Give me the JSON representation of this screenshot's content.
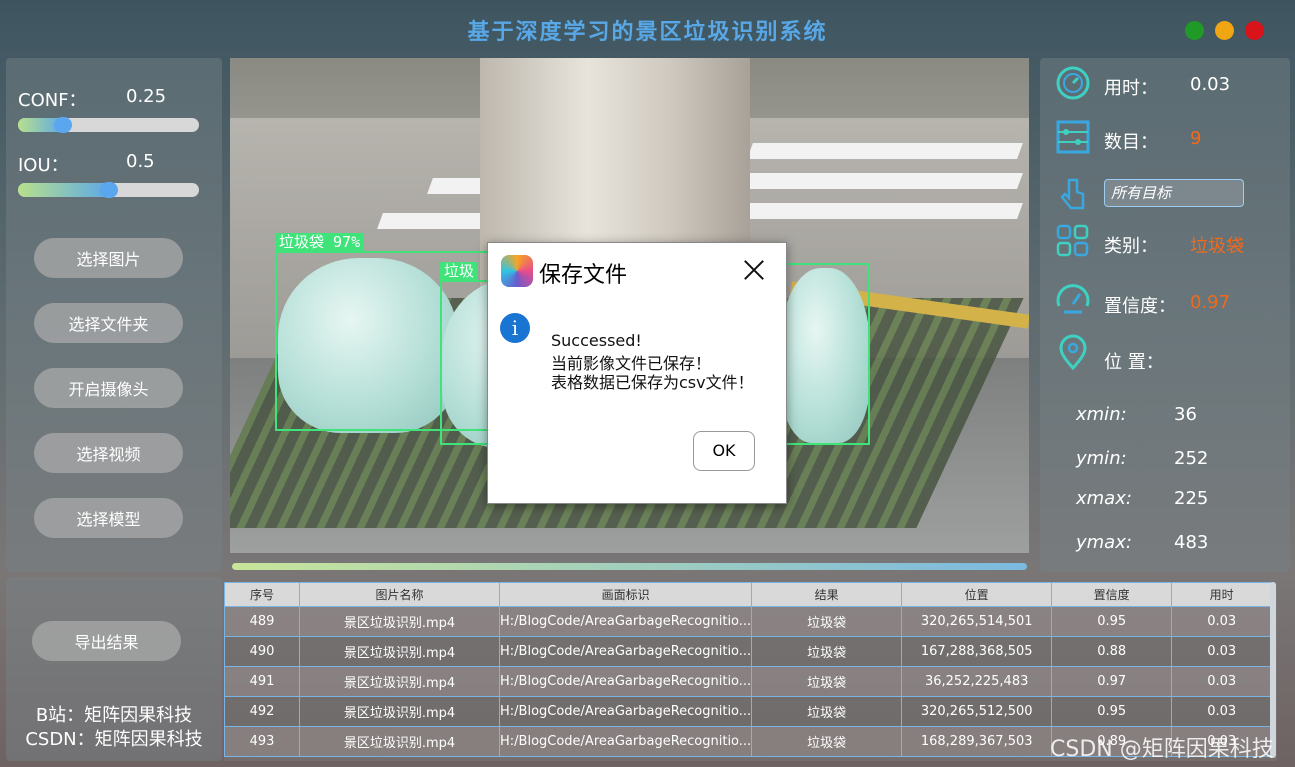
{
  "app": {
    "title": "基于深度学习的景区垃圾识别系统"
  },
  "window_controls": {
    "colors": [
      "#1f9a26",
      "#f0a512",
      "#d9131a"
    ]
  },
  "left_panel": {
    "conf": {
      "label": "CONF：",
      "value": "0.25",
      "fraction": 0.25
    },
    "iou": {
      "label": "IOU：",
      "value": "0.5",
      "fraction": 0.5
    },
    "buttons": [
      "选择图片",
      "选择文件夹",
      "开启摄像头",
      "选择视频",
      "选择模型"
    ],
    "export_button": "导出结果",
    "footer_lines": [
      "B站：矩阵因果科技",
      "CSDN：矩阵因果科技"
    ]
  },
  "detections": [
    {
      "label": "垃圾袋 97%"
    },
    {
      "label": "垃圾"
    }
  ],
  "right_panel": {
    "time": {
      "label": "用时：",
      "value": "0.03",
      "icon": "clock-gauge-icon"
    },
    "count": {
      "label": "数目：",
      "value": "9",
      "icon": "abacus-icon"
    },
    "target_select": {
      "label": "所有目标",
      "icon": "pointer-hand-icon"
    },
    "category": {
      "label": "类别：",
      "value": "垃圾袋",
      "icon": "grid-icon"
    },
    "confidence": {
      "label": "置信度：",
      "value": "0.97",
      "icon": "speedometer-icon"
    },
    "position": {
      "label": "位 置：",
      "icon": "location-pin-icon"
    },
    "coords": [
      {
        "label": "xmin:",
        "value": "36"
      },
      {
        "label": "ymin:",
        "value": "252"
      },
      {
        "label": "xmax:",
        "value": "225"
      },
      {
        "label": "ymax:",
        "value": "483"
      }
    ],
    "value_color": "#f06a1a"
  },
  "table": {
    "headers": [
      "序号",
      "图片名称",
      "画面标识",
      "结果",
      "位置",
      "置信度",
      "用时"
    ],
    "rows": [
      [
        "489",
        "景区垃圾识别.mp4",
        "H:/BlogCode/AreaGarbageRecognitio...",
        "垃圾袋",
        "320,265,514,501",
        "0.95",
        "0.03"
      ],
      [
        "490",
        "景区垃圾识别.mp4",
        "H:/BlogCode/AreaGarbageRecognitio...",
        "垃圾袋",
        "167,288,368,505",
        "0.88",
        "0.03"
      ],
      [
        "491",
        "景区垃圾识别.mp4",
        "H:/BlogCode/AreaGarbageRecognitio...",
        "垃圾袋",
        "36,252,225,483",
        "0.97",
        "0.03"
      ],
      [
        "492",
        "景区垃圾识别.mp4",
        "H:/BlogCode/AreaGarbageRecognitio...",
        "垃圾袋",
        "320,265,512,500",
        "0.95",
        "0.03"
      ],
      [
        "493",
        "景区垃圾识别.mp4",
        "H:/BlogCode/AreaGarbageRecognitio...",
        "垃圾袋",
        "168,289,367,503",
        "0.89",
        "0.03"
      ]
    ]
  },
  "dialog": {
    "title": "保存文件",
    "lines": [
      "Successed!",
      "当前影像文件已保存！",
      "表格数据已保存为csv文件！"
    ],
    "ok": "OK"
  },
  "watermark": "CSDN @矩阵因果科技"
}
